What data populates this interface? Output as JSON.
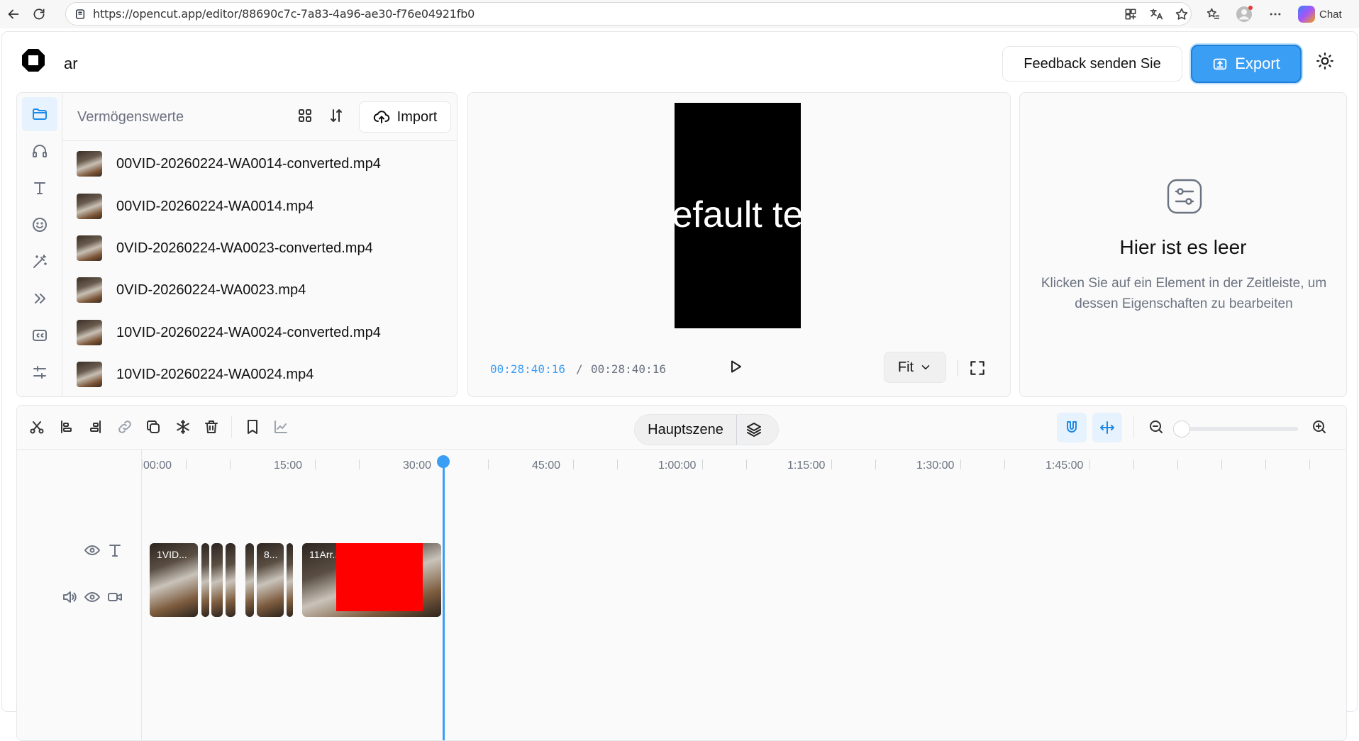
{
  "browser": {
    "url": "https://opencut.app/editor/88690c7c-7a83-4a96-ae30-f76e04921fb0",
    "chat_label": "Chat"
  },
  "header": {
    "project_name": "ar",
    "feedback_label": "Feedback senden Sie",
    "export_label": "Export"
  },
  "assets": {
    "title": "Vermögenswerte",
    "import_label": "Import",
    "items": [
      {
        "name": "00VID-20260224-WA0014-converted.mp4"
      },
      {
        "name": "00VID-20260224-WA0014.mp4"
      },
      {
        "name": "0VID-20260224-WA0023-converted.mp4"
      },
      {
        "name": "0VID-20260224-WA0023.mp4"
      },
      {
        "name": "10VID-20260224-WA0024-converted.mp4"
      },
      {
        "name": "10VID-20260224-WA0024.mp4"
      }
    ]
  },
  "preview": {
    "overlay_text": "efault te",
    "current_time": "00:28:40:16",
    "separator": "/",
    "total_time": "00:28:40:16",
    "fit_label": "Fit"
  },
  "properties": {
    "empty_title": "Hier ist es leer",
    "empty_desc": "Klicken Sie auf ein Element in der Zeitleiste, um dessen Eigenschaften zu bearbeiten"
  },
  "timeline": {
    "scene_label": "Hauptszene",
    "ruler_labels": [
      "00:00",
      "15:00",
      "30:00",
      "45:00",
      "1:00:00",
      "1:15:00",
      "1:30:00",
      "1:45:00"
    ],
    "clips": [
      {
        "label": "1VID..."
      },
      {
        "label": ""
      },
      {
        "label": ""
      },
      {
        "label": ""
      },
      {
        "label": ""
      },
      {
        "label": "8..."
      },
      {
        "label": ""
      },
      {
        "label": "11Arr..."
      }
    ],
    "playhead_time": "00:28:40:16"
  },
  "colors": {
    "accent": "#3b9ef5",
    "overlay_red": "#ff0000"
  }
}
